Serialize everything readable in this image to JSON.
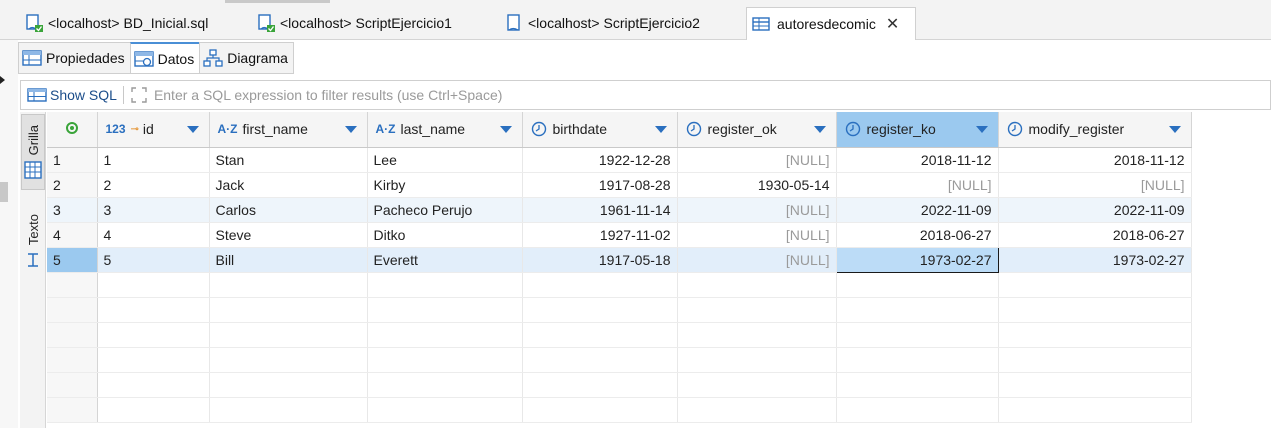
{
  "editor_tabs": [
    {
      "label": "<localhost> BD_Inicial.sql",
      "icon": "sql-script-icon"
    },
    {
      "label": "<localhost> ScriptEjercicio1",
      "icon": "sql-script-icon"
    },
    {
      "label": "<localhost> ScriptEjercicio2",
      "icon": "script-icon"
    },
    {
      "label": "autoresdecomic",
      "icon": "table-icon",
      "active": true,
      "close": "✕"
    }
  ],
  "sub_tabs": [
    {
      "label": "Propiedades",
      "icon": "properties-icon"
    },
    {
      "label": "Datos",
      "icon": "data-icon",
      "active": true
    },
    {
      "label": "Diagrama",
      "icon": "diagram-icon"
    }
  ],
  "filter": {
    "show_sql": "Show SQL",
    "placeholder": "Enter a SQL expression to filter results (use Ctrl+Space)"
  },
  "side_tabs": {
    "grid": "Grilla",
    "text": "Texto"
  },
  "table": {
    "columns": [
      {
        "name": "id",
        "type_icon": "123"
      },
      {
        "name": "first_name",
        "type_icon": "A-Z"
      },
      {
        "name": "last_name",
        "type_icon": "A-Z"
      },
      {
        "name": "birthdate",
        "type_icon": "clock"
      },
      {
        "name": "register_ok",
        "type_icon": "clock"
      },
      {
        "name": "register_ko",
        "type_icon": "clock",
        "selected": true
      },
      {
        "name": "modify_register",
        "type_icon": "clock"
      }
    ],
    "rows": [
      {
        "n": "1",
        "id": "1",
        "first_name": "Stan",
        "last_name": "Lee",
        "birthdate": "1922-12-28",
        "register_ok": "[NULL]",
        "register_ko": "2018-11-12",
        "modify_register": "2018-11-12"
      },
      {
        "n": "2",
        "id": "2",
        "first_name": "Jack",
        "last_name": "Kirby",
        "birthdate": "1917-08-28",
        "register_ok": "1930-05-14",
        "register_ko": "[NULL]",
        "modify_register": "[NULL]"
      },
      {
        "n": "3",
        "id": "3",
        "first_name": "Carlos",
        "last_name": "Pacheco Perujo",
        "birthdate": "1961-11-14",
        "register_ok": "[NULL]",
        "register_ko": "2022-11-09",
        "modify_register": "2022-11-09"
      },
      {
        "n": "4",
        "id": "4",
        "first_name": "Steve",
        "last_name": "Ditko",
        "birthdate": "1927-11-02",
        "register_ok": "[NULL]",
        "register_ko": "2018-06-27",
        "modify_register": "2018-06-27"
      },
      {
        "n": "5",
        "id": "5",
        "first_name": "Bill",
        "last_name": "Everett",
        "birthdate": "1917-05-18",
        "register_ok": "[NULL]",
        "register_ko": "1973-02-27",
        "modify_register": "1973-02-27"
      }
    ],
    "selected_row": 5,
    "selected_column": "register_ko"
  },
  "colors": {
    "accent": "#2a6fbf",
    "selection": "#9bc9ef",
    "null_text": "#9a9a9a"
  }
}
